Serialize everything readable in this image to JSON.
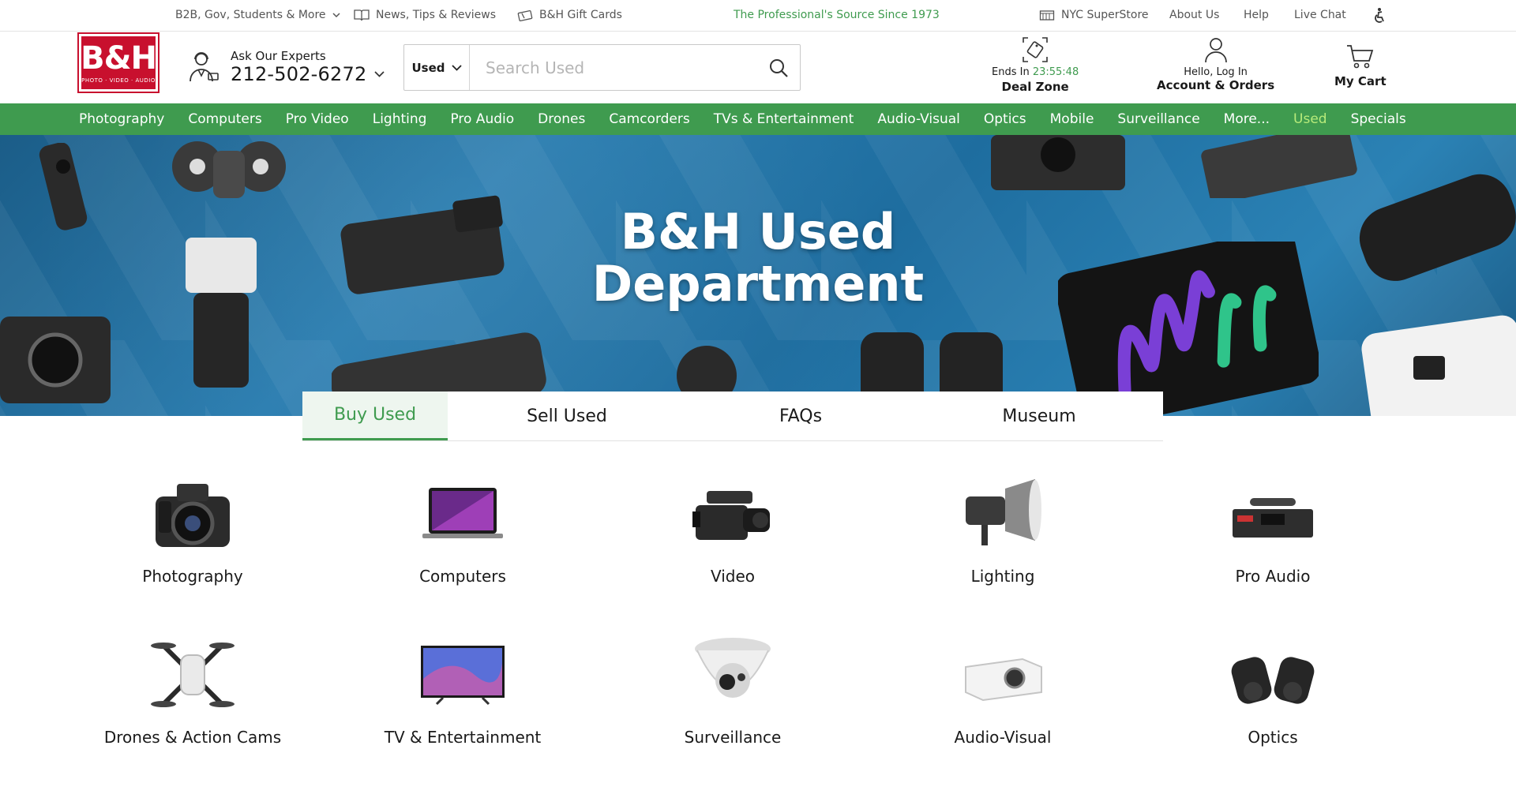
{
  "utility": {
    "b2b": "B2B, Gov, Students & More",
    "news": "News, Tips & Reviews",
    "gift": "B&H Gift Cards",
    "tagline": "The Professional's Source Since 1973",
    "store": "NYC SuperStore",
    "about": "About Us",
    "help": "Help",
    "chat": "Live Chat"
  },
  "logo": {
    "mark": "B&H",
    "sub": "PHOTO · VIDEO · AUDIO"
  },
  "experts": {
    "label": "Ask Our Experts",
    "phone": "212-502-6272"
  },
  "search": {
    "scope": "Used",
    "placeholder": "Search Used",
    "value": ""
  },
  "deal": {
    "ends": "Ends In",
    "timer": "23:55:48",
    "label": "Deal Zone"
  },
  "account": {
    "greeting": "Hello, Log In",
    "label": "Account & Orders"
  },
  "cart": {
    "label": "My Cart"
  },
  "nav": [
    "Photography",
    "Computers",
    "Pro Video",
    "Lighting",
    "Pro Audio",
    "Drones",
    "Camcorders",
    "TVs & Entertainment",
    "Audio-Visual",
    "Optics",
    "Mobile",
    "Surveillance",
    "More...",
    "Used",
    "Specials"
  ],
  "hero": {
    "line1": "B&H Used",
    "line2": "Department"
  },
  "tabs": [
    "Buy Used",
    "Sell Used",
    "FAQs",
    "Museum"
  ],
  "categories": [
    {
      "label": "Photography",
      "icon": "camera-icon"
    },
    {
      "label": "Computers",
      "icon": "laptop-icon"
    },
    {
      "label": "Video",
      "icon": "camcorder-icon"
    },
    {
      "label": "Lighting",
      "icon": "studio-light-icon"
    },
    {
      "label": "Pro Audio",
      "icon": "wireless-receiver-icon"
    },
    {
      "label": "Drones & Action Cams",
      "icon": "drone-icon"
    },
    {
      "label": "TV & Entertainment",
      "icon": "tv-icon"
    },
    {
      "label": "Surveillance",
      "icon": "security-camera-icon"
    },
    {
      "label": "Audio-Visual",
      "icon": "projector-icon"
    },
    {
      "label": "Optics",
      "icon": "binoculars-icon"
    }
  ],
  "colors": {
    "brand_green": "#3f9b4f",
    "brand_red": "#c8102e",
    "active_nav": "#b7eb7a"
  }
}
